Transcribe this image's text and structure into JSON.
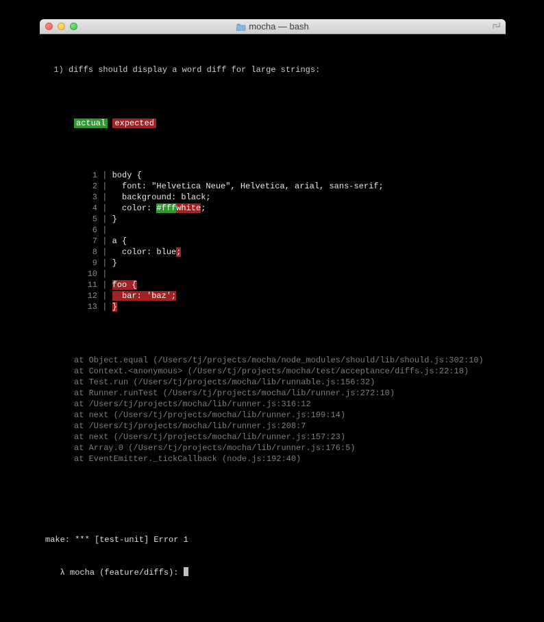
{
  "window": {
    "title": "mocha — bash"
  },
  "test": {
    "number": "1)",
    "title": "diffs should display a word diff for large strings:"
  },
  "legend": {
    "actual": "actual",
    "expected": "expected"
  },
  "diff": {
    "lines": [
      {
        "n": "1",
        "segs": [
          {
            "t": "body {",
            "c": "code"
          }
        ]
      },
      {
        "n": "2",
        "segs": [
          {
            "t": "  font: \"Helvetica Neue\", Helvetica, arial, sans-serif;",
            "c": "code"
          }
        ]
      },
      {
        "n": "3",
        "segs": [
          {
            "t": "  background: black;",
            "c": "code"
          }
        ]
      },
      {
        "n": "4",
        "segs": [
          {
            "t": "  color: ",
            "c": "code"
          },
          {
            "t": "#fff",
            "c": "removed"
          },
          {
            "t": "white",
            "c": "added"
          },
          {
            "t": ";",
            "c": "code"
          }
        ]
      },
      {
        "n": "5",
        "segs": [
          {
            "t": "}",
            "c": "code"
          }
        ]
      },
      {
        "n": "6",
        "segs": []
      },
      {
        "n": "7",
        "segs": [
          {
            "t": "a {",
            "c": "code"
          }
        ]
      },
      {
        "n": "8",
        "segs": [
          {
            "t": "  color: blue",
            "c": "code"
          },
          {
            "t": ";",
            "c": "added"
          }
        ]
      },
      {
        "n": "9",
        "segs": [
          {
            "t": "}",
            "c": "code"
          }
        ]
      },
      {
        "n": "10",
        "segs": []
      },
      {
        "n": "11",
        "segs": [
          {
            "t": "foo {",
            "c": "added"
          }
        ]
      },
      {
        "n": "12",
        "segs": [
          {
            "t": "  bar: 'baz';",
            "c": "added"
          }
        ]
      },
      {
        "n": "13",
        "segs": [
          {
            "t": "}",
            "c": "added"
          }
        ]
      }
    ]
  },
  "stack": [
    "at Object.equal (/Users/tj/projects/mocha/node_modules/should/lib/should.js:302:10)",
    "at Context.<anonymous> (/Users/tj/projects/mocha/test/acceptance/diffs.js:22:18)",
    "at Test.run (/Users/tj/projects/mocha/lib/runnable.js:156:32)",
    "at Runner.runTest (/Users/tj/projects/mocha/lib/runner.js:272:10)",
    "at /Users/tj/projects/mocha/lib/runner.js:316:12",
    "at next (/Users/tj/projects/mocha/lib/runner.js:199:14)",
    "at /Users/tj/projects/mocha/lib/runner.js:208:7",
    "at next (/Users/tj/projects/mocha/lib/runner.js:157:23)",
    "at Array.0 (/Users/tj/projects/mocha/lib/runner.js:176:5)",
    "at EventEmitter._tickCallback (node.js:192:40)"
  ],
  "footer": {
    "make": "make: *** [test-unit] Error 1",
    "prompt_lambda": "λ",
    "prompt_text": "mocha (feature/diffs): "
  }
}
